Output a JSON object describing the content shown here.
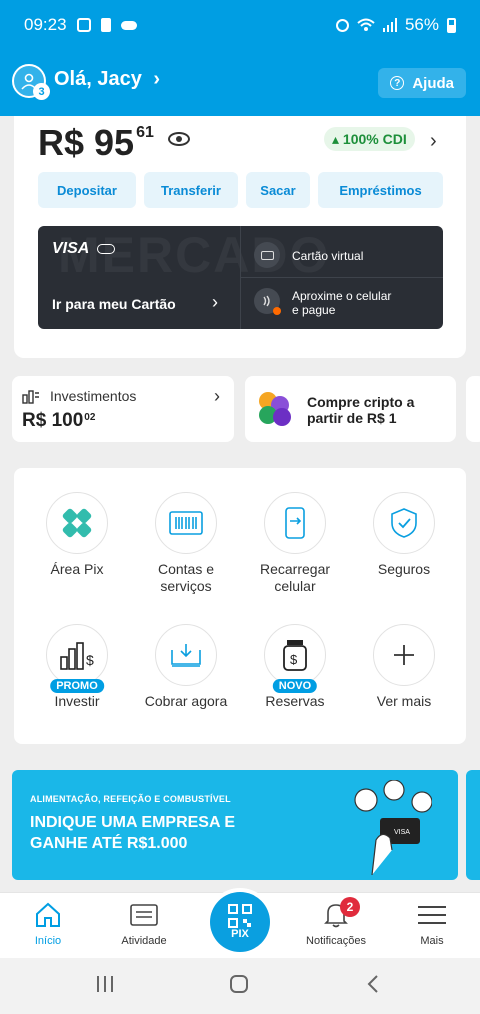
{
  "status_bar": {
    "time": "09:23",
    "battery": "56%"
  },
  "header": {
    "greeting": "Olá, Jacy",
    "avatar_badge": "3",
    "help_label": "Ajuda"
  },
  "balance": {
    "integer": "R$ 95",
    "cents": "61",
    "cdi_label": "▴ 100% CDI"
  },
  "actions": [
    "Depositar",
    "Transferir",
    "Sacar",
    "Empréstimos"
  ],
  "card": {
    "brand": "VISA",
    "watermark": "MERCADO",
    "go_to_card": "Ir para meu Cartão",
    "virtual_card": "Cartão virtual",
    "contactless_line1": "Aproxime o celular",
    "contactless_line2": "e pague"
  },
  "investments": {
    "title": "Investimentos",
    "integer": "R$ 100",
    "cents": "02"
  },
  "crypto": {
    "line1": "Compre cripto a",
    "line2": "partir de R$ 1"
  },
  "grid": [
    {
      "line1": "Área Pix",
      "line2": "",
      "tag": ""
    },
    {
      "line1": "Contas e",
      "line2": "serviços",
      "tag": ""
    },
    {
      "line1": "Recarregar",
      "line2": "celular",
      "tag": ""
    },
    {
      "line1": "Seguros",
      "line2": "",
      "tag": ""
    },
    {
      "line1": "Investir",
      "line2": "",
      "tag": "PROMO"
    },
    {
      "line1": "Cobrar agora",
      "line2": "",
      "tag": ""
    },
    {
      "line1": "Reservas",
      "line2": "",
      "tag": "NOVO"
    },
    {
      "line1": "Ver mais",
      "line2": "",
      "tag": ""
    }
  ],
  "banner": {
    "subtitle": "ALIMENTAÇÃO, REFEIÇÃO E COMBUSTÍVEL",
    "title_line1": "INDIQUE UMA EMPRESA E",
    "title_line2": "GANHE ATÉ R$1.000",
    "card_label": "VISA"
  },
  "bottom_nav": {
    "home": "Início",
    "activity": "Atividade",
    "pix": "PIX",
    "notifications": "Notificações",
    "notifications_badge": "2",
    "more": "Mais"
  },
  "colors": {
    "brand_blue": "#009ee3",
    "banner_blue": "#1ab7e8",
    "card_dark": "#2a2e35",
    "cdi_green": "#1d8f3a"
  }
}
